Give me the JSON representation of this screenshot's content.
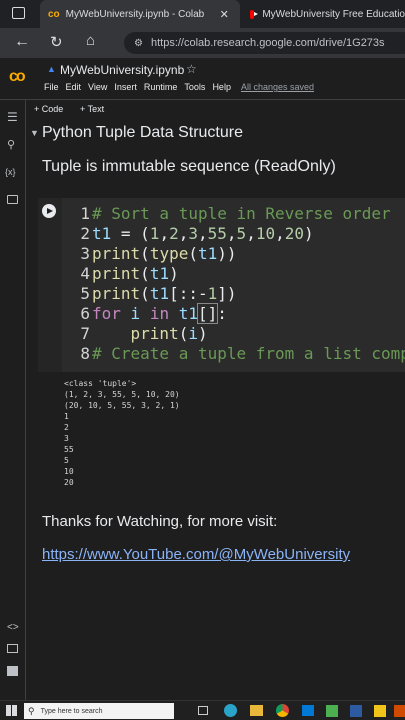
{
  "browser": {
    "tabs": [
      {
        "label": "MyWebUniversity.ipynb - Colab"
      },
      {
        "label": "MyWebUniversity Free Educatio"
      }
    ],
    "url": "https://colab.research.google.com/drive/1G273s"
  },
  "notebook": {
    "title": "MyWebUniversity.ipynb",
    "menu": [
      "File",
      "Edit",
      "View",
      "Insert",
      "Runtime",
      "Tools",
      "Help"
    ],
    "save_status": "All changes saved",
    "add_code": "+ Code",
    "add_text": "+ Text"
  },
  "section": {
    "heading": "Python Tuple Data Structure",
    "subtext": "Tuple is immutable sequence (ReadOnly)"
  },
  "code": {
    "line_numbers": [
      "1",
      "2",
      "3",
      "4",
      "5",
      "6",
      "7",
      "8"
    ]
  },
  "output": {
    "lines": [
      "<class 'tuple'>",
      "(1, 2, 3, 55, 5, 10, 20)",
      "(20, 10, 5, 55, 3, 2, 1)",
      "1",
      "2",
      "3",
      "55",
      "5",
      "10",
      "20"
    ]
  },
  "footer": {
    "thanks": "Thanks for Watching, for more visit:",
    "link": "https://www.YouTube.com/@MyWebUniversity"
  },
  "taskbar": {
    "search_placeholder": "Type here to search"
  }
}
